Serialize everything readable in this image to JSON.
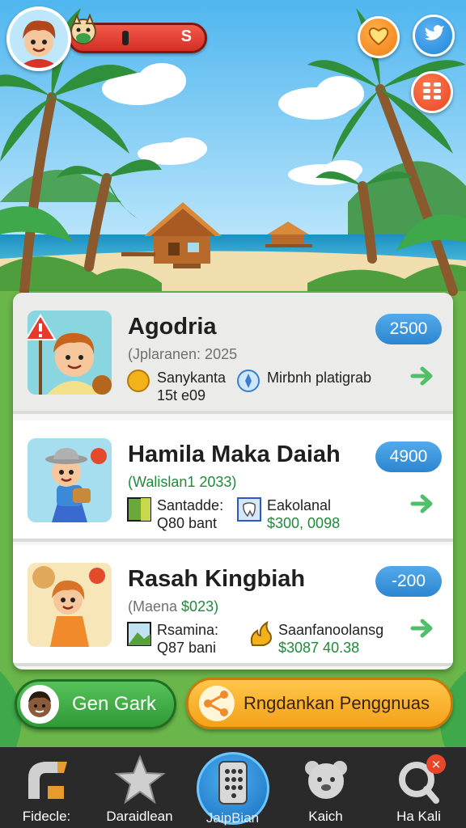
{
  "hud": {
    "coin_symbol": "S",
    "avatar_icon": "boy-avatar-icon",
    "pet_icon": "pet-icon",
    "buttons": [
      {
        "icon": "heart-icon",
        "color": "#ef7d12"
      },
      {
        "icon": "bird-icon",
        "color": "#1d86d8"
      },
      {
        "icon": "menu-grid-icon",
        "color": "#e8461e"
      }
    ]
  },
  "list": [
    {
      "title": "Agodria",
      "subtitle": "(Jplaranen: 2025",
      "badge": "2500",
      "selected": true,
      "stat1": {
        "icon": "gold-coin-icon",
        "line1": "Sanykanta",
        "line2": "15t e09"
      },
      "stat2": {
        "icon": "compass-icon",
        "line1": "Mirbnh platigrab",
        "line2": ""
      }
    },
    {
      "title": "Hamila Maka Daiah",
      "subtitle": "(Walislan1 2033)",
      "badge": "4900",
      "selected": false,
      "stat1": {
        "icon": "land-icon",
        "line1": "Santadde:",
        "line2": "Q80 bant"
      },
      "stat2": {
        "icon": "tooth-icon",
        "line1": "Eakolanal",
        "line2": "$300, 0098"
      }
    },
    {
      "title": "Rasah Kingbiah",
      "subtitle_prefix": "(Maena ",
      "subtitle_value": "$023)",
      "badge": "-200",
      "selected": false,
      "stat1": {
        "icon": "land-icon",
        "line1": "Rsamina:",
        "line2": "Q87 bani"
      },
      "stat2": {
        "icon": "flame-icon",
        "line1": "Saanfanoolansg",
        "line2": "$3087 40.38"
      }
    }
  ],
  "actions": {
    "gen_label": "Gen Gark",
    "share_label": "Rngdankan Penggnuas"
  },
  "nav": [
    {
      "label": "Fidecle:",
      "icon": "swirl-icon"
    },
    {
      "label": "Daraidlean",
      "icon": "star-icon"
    },
    {
      "label": "JaipBian",
      "icon": "phone-grid-icon",
      "active": true
    },
    {
      "label": "Kaich",
      "icon": "bear-icon"
    },
    {
      "label": "Ha Kali",
      "icon": "search-icon",
      "notification": "×"
    }
  ],
  "colors": {
    "badge_blue": "#2c86cf",
    "gen_green": "#2f9a36",
    "share_orange": "#f4a11a",
    "value_green": "#1f8a3a",
    "nav_bg": "#2a2a2a"
  }
}
